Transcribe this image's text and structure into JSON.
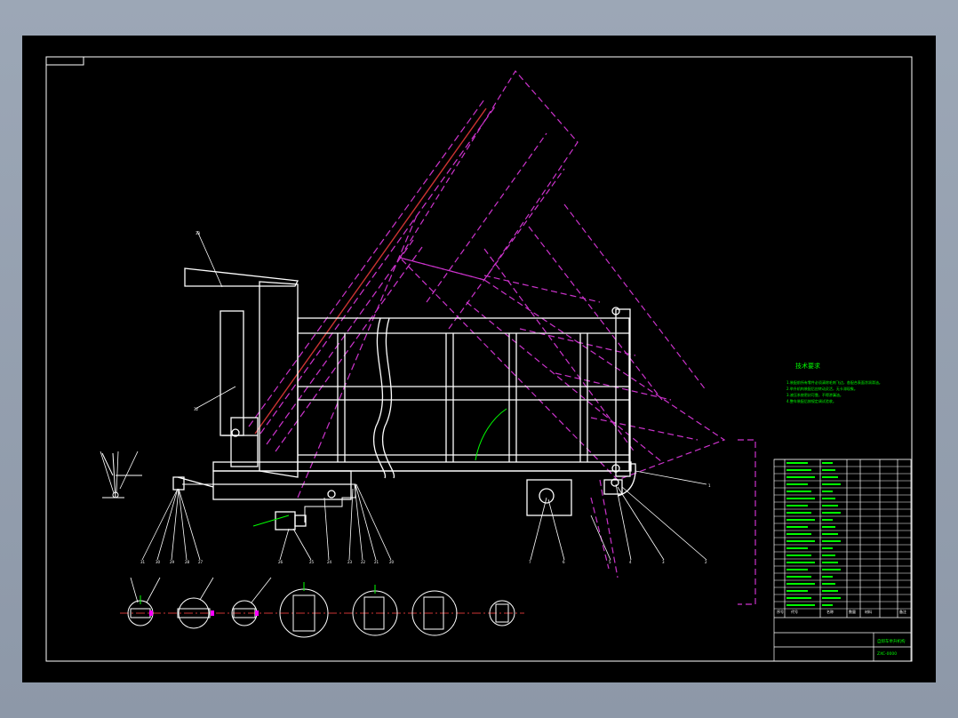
{
  "colors": {
    "background": "#000000",
    "frame": "#ffffff",
    "geometry": "#ffffff",
    "dashed_tilted": "#cc33cc",
    "notes": "#00ff00",
    "table_text": "#00ff00",
    "marker": "#ff00ff"
  },
  "notes": {
    "title": "技术要求",
    "lines": [
      "1.装配前所有零件必须清除毛刺飞边，各配合表面涂润滑油。",
      "2.举升机构装配后应转动灵活，无卡滞现象。",
      "3.液压系统密封可靠，不得渗漏油。",
      "4.整车装配后按规定调试验收。"
    ]
  },
  "title_block": {
    "drawing_name": "自卸车举升机构",
    "drawing_no": "ZXC-0000",
    "col_seq": "序号",
    "col_code": "代号",
    "col_name": "名称",
    "col_qty": "数量",
    "col_material": "材料",
    "col_note": "备注"
  }
}
